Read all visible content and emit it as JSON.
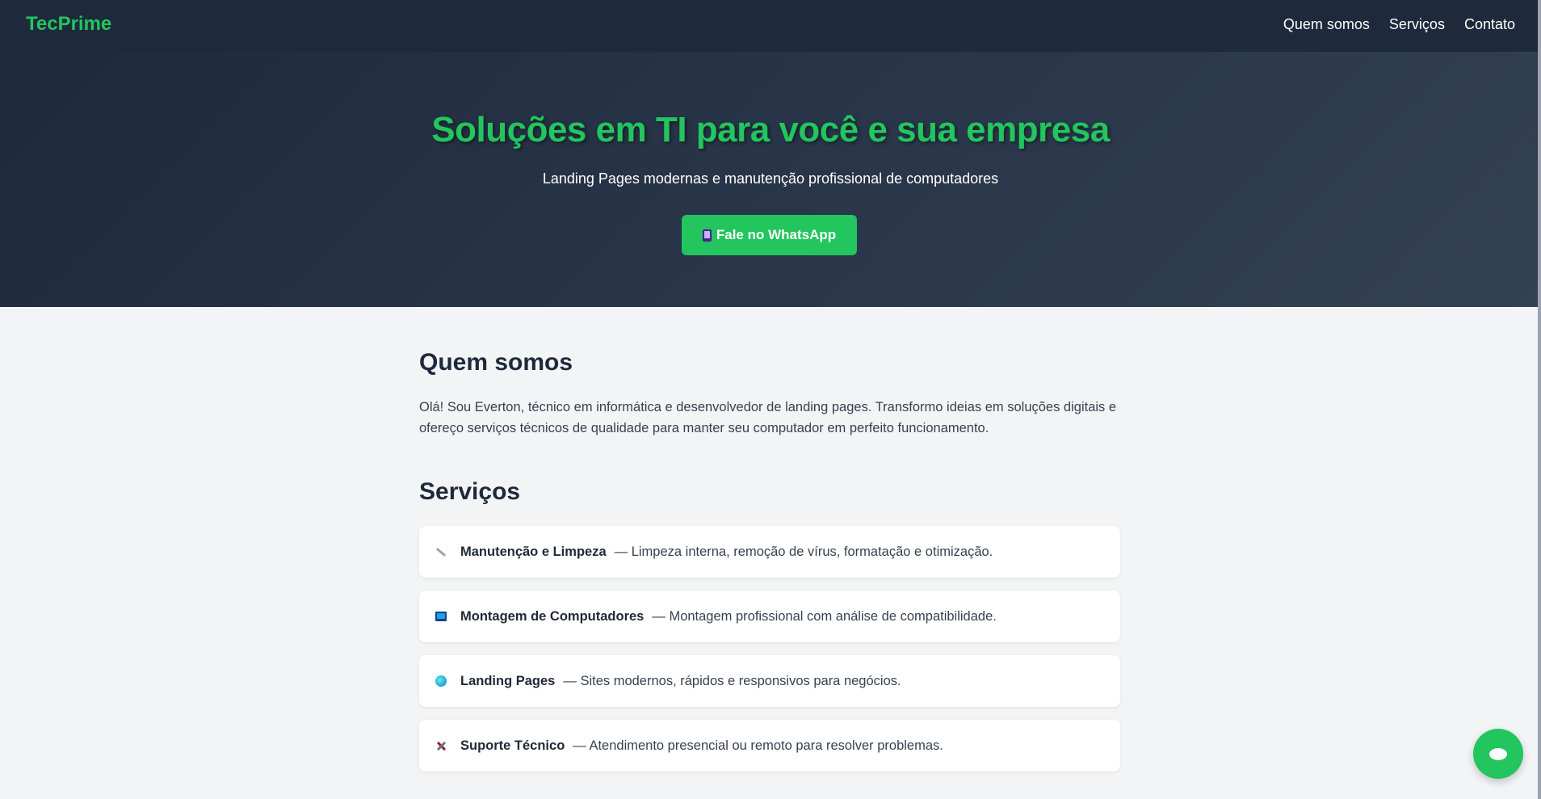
{
  "header": {
    "logo": "TecPrime",
    "nav": [
      {
        "label": "Quem somos"
      },
      {
        "label": "Serviços"
      },
      {
        "label": "Contato"
      }
    ]
  },
  "hero": {
    "title": "Soluções em TI para você e sua empresa",
    "subtitle": "Landing Pages modernas e manutenção profissional de computadores",
    "cta_label": "Fale no WhatsApp",
    "cta_icon": "mobile-phone-icon"
  },
  "about": {
    "heading": "Quem somos",
    "text": "Olá! Sou Everton, técnico em informática e desenvolvedor de landing pages. Transformo ideias em soluções digitais e ofereço serviços técnicos de qualidade para manter seu computador em perfeito funcionamento."
  },
  "services": {
    "heading": "Serviços",
    "items": [
      {
        "icon": "wrench-icon",
        "title": "Manutenção e Limpeza",
        "desc": "— Limpeza interna, remoção de vírus, formatação e otimização."
      },
      {
        "icon": "laptop-icon",
        "title": "Montagem de Computadores",
        "desc": "— Montagem profissional com análise de compatibilidade."
      },
      {
        "icon": "globe-icon",
        "title": "Landing Pages",
        "desc": "— Sites modernos, rápidos e responsivos para negócios."
      },
      {
        "icon": "tools-icon",
        "title": "Suporte Técnico",
        "desc": "— Atendimento presencial ou remoto para resolver problemas."
      }
    ]
  },
  "chat_button": {
    "icon": "chat-bubble-icon"
  },
  "colors": {
    "accent": "#22c55e",
    "header_bg": "#1e293b",
    "page_bg": "#f3f4f6"
  }
}
